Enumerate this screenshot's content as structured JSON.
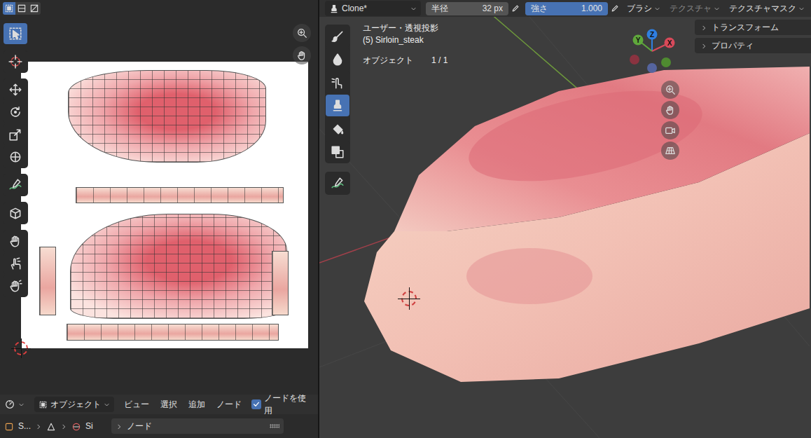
{
  "uv_editor": {
    "select_modes": [
      {
        "selected": true
      },
      {
        "selected": false
      },
      {
        "selected": false
      }
    ],
    "tools": [
      {
        "selected": true
      },
      {
        "selected": false
      },
      {
        "selected": false
      },
      {
        "selected": false
      },
      {
        "selected": false
      },
      {
        "selected": false
      },
      {
        "selected": false
      },
      {
        "selected": false
      },
      {
        "selected": false
      },
      {
        "selected": false
      },
      {
        "selected": false
      }
    ],
    "header": {
      "mode": "オブジェクト",
      "menus": [
        "ビュー",
        "選択",
        "追加",
        "ノード"
      ],
      "use_nodes": {
        "label": "ノードを使用",
        "checked": true
      }
    },
    "breadcrumb": {
      "object": "S...",
      "material": "Si"
    },
    "panels": [
      {
        "label": "ノード",
        "expanded": false
      }
    ]
  },
  "viewport": {
    "header": {
      "brush": "Clone*",
      "fields": [
        {
          "label": "半径",
          "value": "32 px"
        },
        {
          "label": "強さ",
          "value": "1.000",
          "level": 1
        }
      ],
      "menus": [
        {
          "label": "ブラシ",
          "disabled": false
        },
        {
          "label": "テクスチャ",
          "disabled": true
        },
        {
          "label": "テクスチャマスク",
          "disabled": false
        }
      ]
    },
    "overlay": {
      "view": "ユーザー・透視投影",
      "object": "(5) Sirloin_steak",
      "count_label": "オブジェクト",
      "count": "1 / 1"
    },
    "sidebar_tabs": [
      {
        "label": "トランスフォーム",
        "expanded": false
      },
      {
        "label": "プロパティ",
        "expanded": false
      }
    ],
    "gizmo": {
      "axes": [
        {
          "label": "Z",
          "color": "#2f7fe0"
        },
        {
          "label": "Y",
          "color": "#5fa83c"
        },
        {
          "label": "X",
          "color": "#d84a5a"
        }
      ],
      "negative_axes": [
        {
          "color": "#55649e"
        },
        {
          "color": "#4f8a30"
        },
        {
          "color": "#8a3340"
        }
      ]
    },
    "tools": [
      {
        "selected": false
      },
      {
        "selected": false
      },
      {
        "selected": false
      },
      {
        "selected": true
      },
      {
        "selected": false
      },
      {
        "selected": false
      },
      {
        "selected": false
      }
    ]
  }
}
